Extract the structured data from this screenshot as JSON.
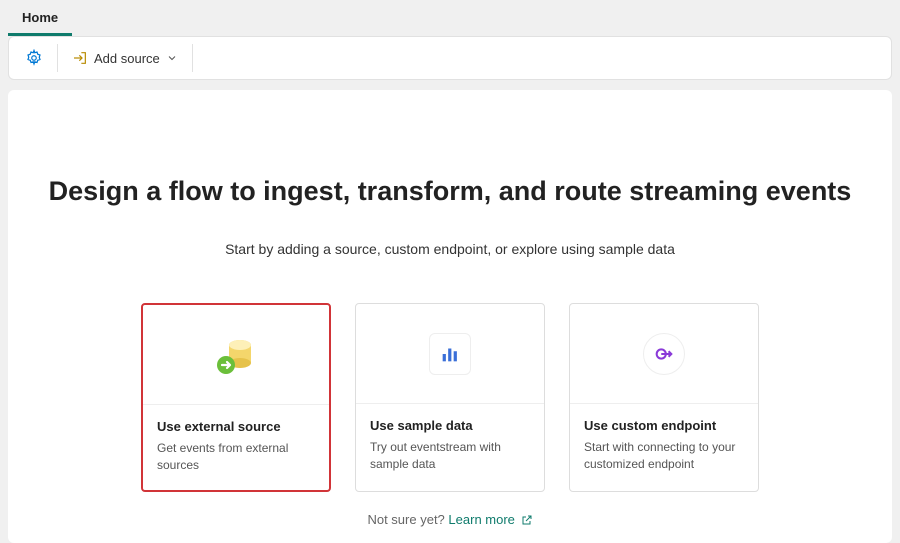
{
  "tab": {
    "label": "Home"
  },
  "toolbar": {
    "add_source_label": "Add source"
  },
  "main": {
    "headline": "Design a flow to ingest, transform, and route streaming events",
    "sub": "Start by adding a source, custom endpoint, or explore using sample data"
  },
  "cards": {
    "external": {
      "title": "Use external source",
      "desc": "Get events from external sources"
    },
    "sample": {
      "title": "Use sample data",
      "desc": "Try out eventstream with sample data"
    },
    "custom": {
      "title": "Use custom endpoint",
      "desc": "Start with connecting to your customized endpoint"
    }
  },
  "footer": {
    "prompt": "Not sure yet?",
    "link": "Learn more"
  }
}
